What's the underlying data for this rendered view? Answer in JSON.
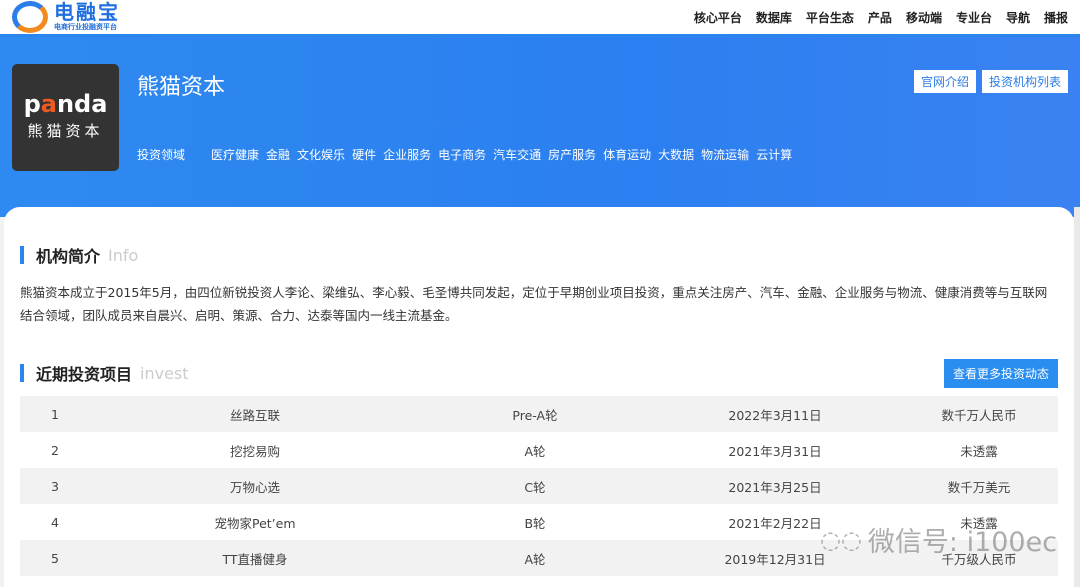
{
  "header": {
    "logo_title": "电融宝",
    "logo_subtitle": "电商行业投融资平台",
    "nav": [
      "核心平台",
      "数据库",
      "平台生态",
      "产品",
      "移动端",
      "专业台",
      "导航",
      "播报"
    ]
  },
  "banner": {
    "logo_en_pre": "p",
    "logo_en_accent": "a",
    "logo_en_post": "nda",
    "logo_cn": "熊猫资本",
    "name": "熊猫资本",
    "fields_label": "投资领域",
    "fields": [
      "医疗健康",
      "金融",
      "文化娱乐",
      "硬件",
      "企业服务",
      "电子商务",
      "汽车交通",
      "房产服务",
      "体育运动",
      "大数据",
      "物流运输",
      "云计算"
    ],
    "buttons": [
      "官网介绍",
      "投资机构列表"
    ]
  },
  "intro": {
    "title": "机构简介",
    "title_en": "Info",
    "text": "熊猫资本成立于2015年5月，由四位新锐投资人李论、梁维弘、李心毅、毛圣博共同发起，定位于早期创业项目投资，重点关注房产、汽车、金融、企业服务与物流、健康消费等与互联网结合领域，团队成员来自晨兴、启明、策源、合力、达泰等国内一线主流基金。"
  },
  "invest": {
    "title": "近期投资项目",
    "title_en": "invest",
    "more": "查看更多投资动态",
    "rows": [
      [
        "1",
        "丝路互联",
        "Pre-A轮",
        "2022年3月11日",
        "数千万人民币"
      ],
      [
        "2",
        "挖挖易购",
        "A轮",
        "2021年3月31日",
        "未透露"
      ],
      [
        "3",
        "万物心选",
        "C轮",
        "2021年3月25日",
        "数千万美元"
      ],
      [
        "4",
        "宠物家Pet’em",
        "B轮",
        "2021年2月22日",
        "未透露"
      ],
      [
        "5",
        "TT直播健身",
        "A轮",
        "2019年12月31日",
        "千万级人民币"
      ]
    ]
  },
  "watermark": "微信号: i100ec"
}
